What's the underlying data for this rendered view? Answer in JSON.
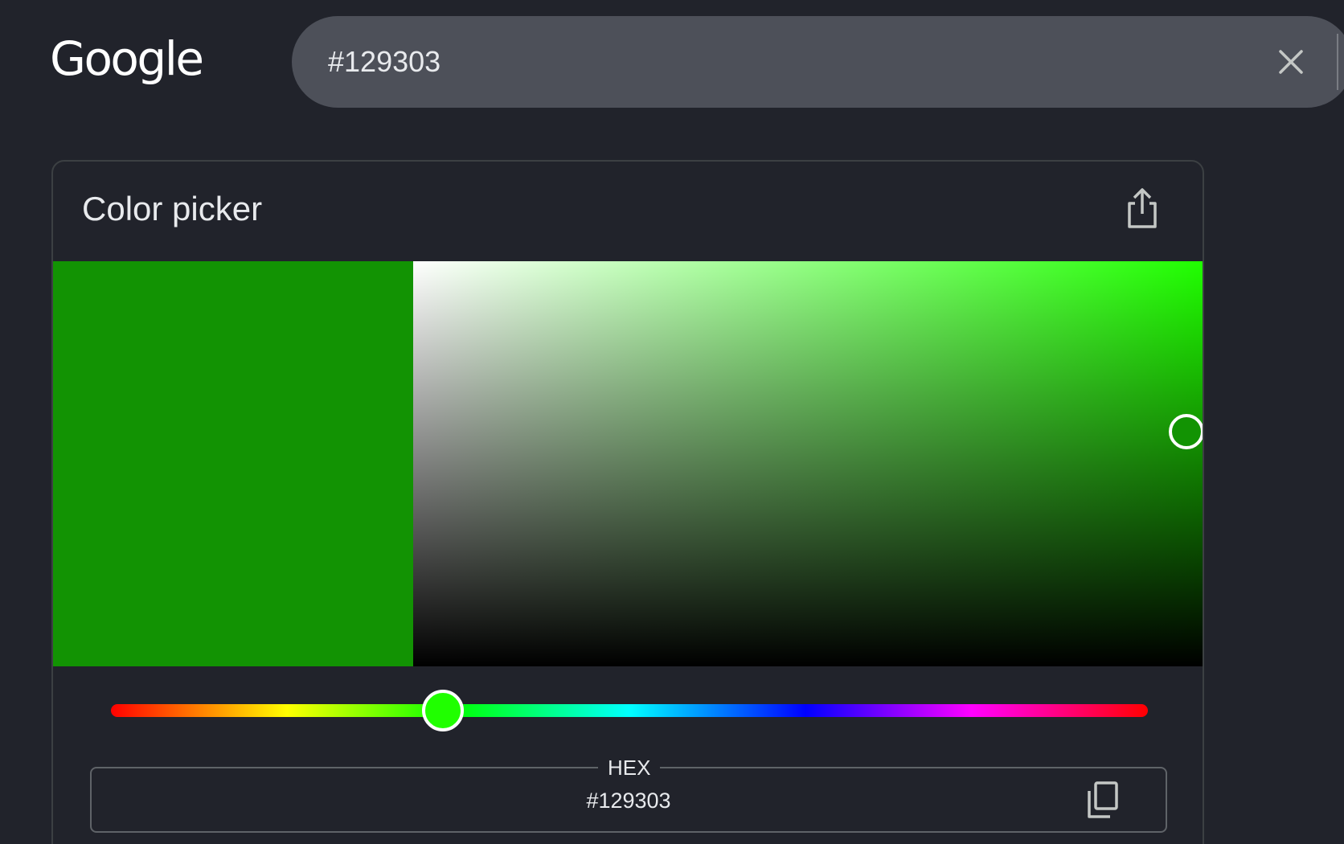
{
  "header": {
    "logo_text": "Google",
    "search_value": "#129303"
  },
  "card": {
    "title": "Color picker",
    "hex_label": "HEX",
    "hex_value": "#129303",
    "selected_color": "#129303",
    "hue_color": "#20ff00",
    "hue_position_fraction": 0.32,
    "saturation_fraction": 0.98,
    "value_fraction": 0.58
  },
  "colors": {
    "background": "#21232b",
    "search_bar": "#4d5059",
    "text": "#e8eaed"
  },
  "icons": {
    "clear": "close-icon",
    "share": "share-icon",
    "copy": "copy-icon"
  }
}
